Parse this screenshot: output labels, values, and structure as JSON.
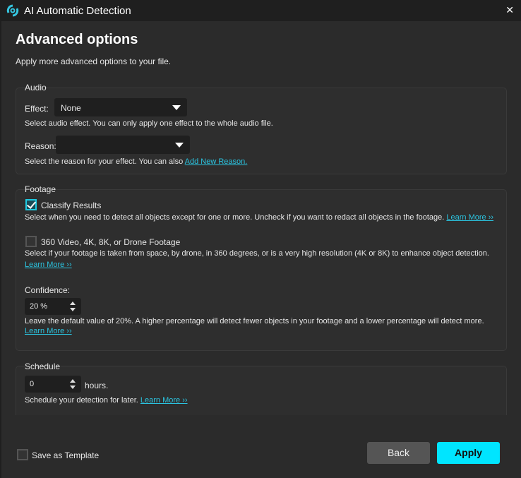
{
  "window": {
    "title": "AI Automatic Detection",
    "close": "✕",
    "logo_icon": "swirl-logo"
  },
  "header": {
    "title": "Advanced options",
    "subtitle": "Apply more advanced options to your file."
  },
  "audio": {
    "label": "Audio",
    "effect_label": "Effect:",
    "effect_value": "None",
    "effect_help": "Select audio effect. You can only apply one effect to the whole audio file.",
    "reason_label": "Reason:",
    "reason_value": "",
    "reason_help": "Select the reason for your effect. You can also ",
    "reason_link": "Add New Reason."
  },
  "footage": {
    "label": "Footage",
    "classify_label": "Classify Results",
    "classify_checked": true,
    "classify_help": "Select when you need to detect all objects except for one or more. Uncheck if you want to redact all objects in the footage. ",
    "learn_more": "Learn More ››",
    "hires_label": "360 Video, 4K, 8K, or Drone Footage",
    "hires_checked": false,
    "hires_help": "Select if your footage is taken from space, by drone, in 360 degrees, or is a very high resolution (4K or 8K) to enhance object detection.",
    "confidence_label": "Confidence:",
    "confidence_value": "20 %",
    "confidence_help": "Leave the default value of 20%. A higher percentage will detect fewer objects in your footage and a lower percentage will detect more."
  },
  "schedule": {
    "label": "Schedule",
    "value": "0",
    "unit": "hours.",
    "help": "Schedule your detection for later. ",
    "learn_more": "Learn More ››"
  },
  "footer": {
    "template_label": "Save as Template",
    "template_checked": false,
    "back": "Back",
    "apply": "Apply"
  },
  "colors": {
    "accent": "#00e5ff",
    "link": "#2bc4e0",
    "background": "#2b2b2b"
  }
}
